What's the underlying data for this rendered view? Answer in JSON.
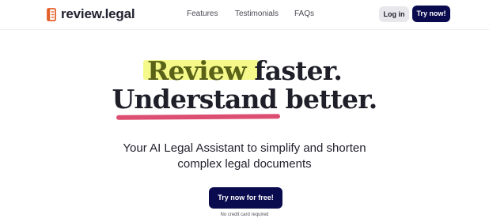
{
  "brand": {
    "name": "review.legal",
    "icon": "document-icon",
    "color": "#e2602a"
  },
  "nav": {
    "links": [
      {
        "label": "Features"
      },
      {
        "label": "Testimonials"
      },
      {
        "label": "FAQs"
      }
    ],
    "login_label": "Log in",
    "try_label": "Try now!"
  },
  "hero": {
    "line1_highlight": "Review",
    "line1_rest": " faster.",
    "line2": "Understand better.",
    "subtitle": "Your AI Legal Assistant to simplify and shorten complex legal documents",
    "cta_label": "Try now for free!",
    "cta_note": "No credit card required"
  },
  "colors": {
    "primary": "#0a0a4f",
    "highlight": "#f4f98a",
    "underline": "#dc4f72",
    "brand_icon": "#e2602a"
  }
}
